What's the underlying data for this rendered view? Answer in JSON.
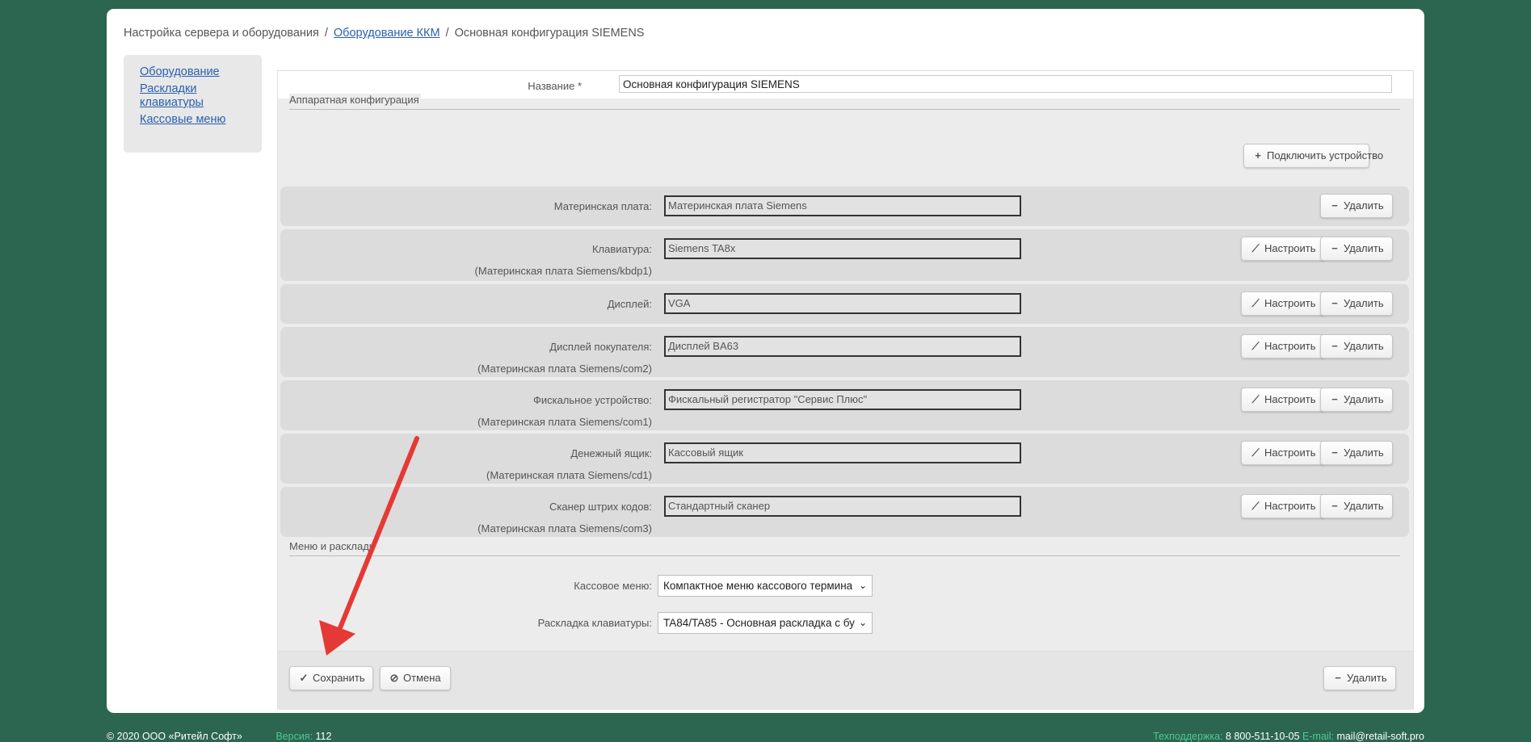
{
  "breadcrumb": {
    "item1": "Настройка сервера и оборудования",
    "item2": "Оборудование ККМ",
    "item3": "Основная конфигурация SIEMENS",
    "separator": "/"
  },
  "sidebar": {
    "items": [
      {
        "label": "Оборудование"
      },
      {
        "label": "Раскладки клавиатуры"
      },
      {
        "label": "Кассовые меню"
      }
    ]
  },
  "form": {
    "name_label": "Название *",
    "name_value": "Основная конфигурация SIEMENS",
    "hardware_legend": "Аппаратная конфигурация",
    "connect_button": "Подключить устройство",
    "configure_label": "Настроить",
    "delete_label": "Удалить",
    "devices": [
      {
        "label": "Материнская плата:",
        "sub": "",
        "value": "Материнская плата Siemens"
      },
      {
        "label": "Клавиатура:",
        "sub": "(Материнская плата Siemens/kbdp1)",
        "value": "Siemens TA8x"
      },
      {
        "label": "Дисплей:",
        "sub": "",
        "value": "VGA"
      },
      {
        "label": "Дисплей покупателя:",
        "sub": "(Материнская плата Siemens/com2)",
        "value": "Дисплей BA63"
      },
      {
        "label": "Фискальное устройство:",
        "sub": "(Материнская плата Siemens/com1)",
        "value": "Фискальный регистратор \"Сервис Плюс\""
      },
      {
        "label": "Денежный ящик:",
        "sub": "(Материнская плата Siemens/cd1)",
        "value": "Кассовый ящик"
      },
      {
        "label": "Сканер штрих кодов:",
        "sub": "(Материнская плата Siemens/com3)",
        "value": "Стандартный сканер"
      }
    ],
    "menu_legend": "Меню и раскладк",
    "cash_menu_label": "Кассовое меню:",
    "cash_menu_value": "Компактное меню кассового термина",
    "keyboard_label": "Раскладка клавиатуры:",
    "keyboard_value": "TA84/TA85 - Основная раскладка с бу",
    "save_button": "Сохранить",
    "cancel_button": "Отмена",
    "delete_button": "Удалить"
  },
  "footer": {
    "copyright": "© 2020 ООО «Ритейл Софт»",
    "version_label": "Версия:",
    "version_value": "112",
    "support_label": "Техподдержка:",
    "support_phone": "8 800-511-10-05",
    "email_label": "E-mail:",
    "email_value": "mail@retail-soft.pro"
  },
  "icons": {
    "plus": "plus-icon",
    "minus": "minus-icon",
    "wrench": "wrench-icon",
    "check": "check-icon",
    "cancel": "cancel-icon",
    "chevron": "chevron-down-icon"
  },
  "colors": {
    "background": "#2c6650",
    "link": "#2a5fae",
    "arrow": "#e53935",
    "footer_accent": "#4ec98f"
  }
}
